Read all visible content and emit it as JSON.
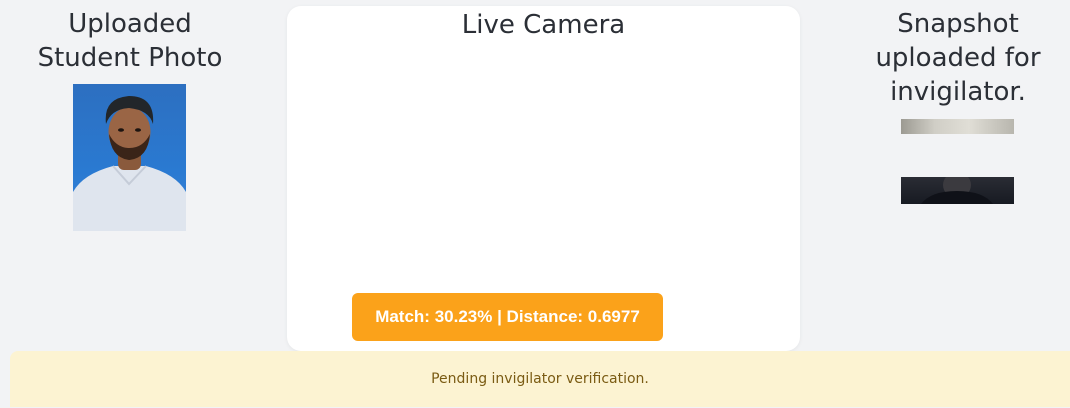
{
  "student": {
    "title": "Uploaded Student Photo"
  },
  "camera": {
    "title": "Live Camera",
    "match_text": "Match: 30.23% | Distance: 0.6977",
    "match_percent": 30.23,
    "distance": 0.6977,
    "badge_color": "#fba21a"
  },
  "snapshot": {
    "title": "Snapshot uploaded for invigilator."
  },
  "status": {
    "message": "Pending invigilator verification.",
    "background_color": "#fcf3d2"
  }
}
